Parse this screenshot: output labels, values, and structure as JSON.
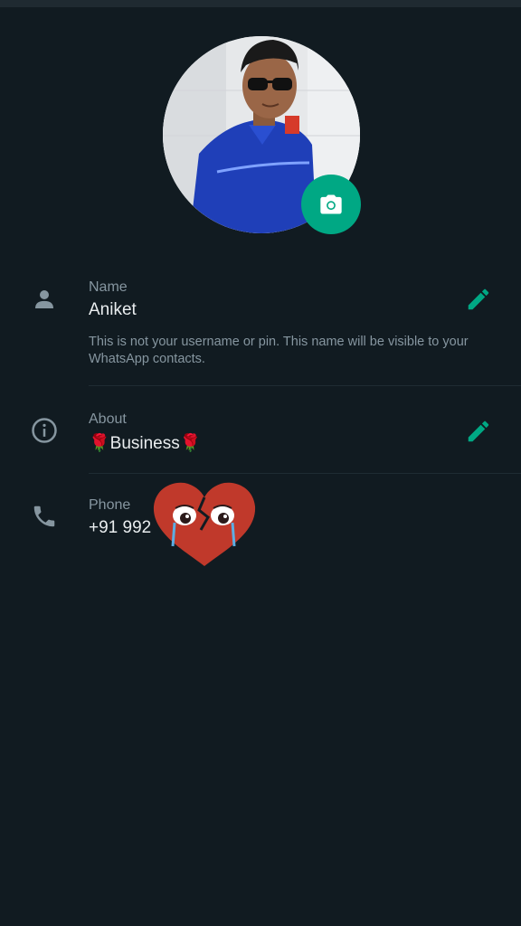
{
  "profile": {
    "photo_alt": "Profile photo",
    "camera_button_icon": "camera-icon"
  },
  "name": {
    "label": "Name",
    "value": "Aniket",
    "hint": "This is not your username or pin. This name will be visible to your WhatsApp contacts.",
    "icon": "person-icon",
    "edit_icon": "pencil-icon"
  },
  "about": {
    "label": "About",
    "value": "🌹Business🌹",
    "icon": "info-icon",
    "edit_icon": "pencil-icon"
  },
  "phone": {
    "label": "Phone",
    "value": "+91 992",
    "icon": "phone-icon"
  },
  "overlay": {
    "sticker": "broken-heart-crying-sticker"
  },
  "colors": {
    "background": "#111b21",
    "accent": "#00a884",
    "label": "#8696a0",
    "text": "#e9edef"
  }
}
